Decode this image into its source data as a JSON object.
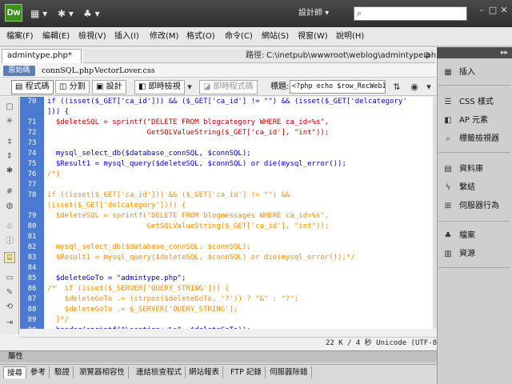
{
  "titlebar": {
    "logo": "Dw",
    "workspace": "設計師 ▾",
    "search_placeholder": "",
    "layout_icon": "layout-icon",
    "gear_icon": "gear-icon",
    "site_icon": "site-icon"
  },
  "menu": [
    "檔案(F)",
    "編輯(E)",
    "檢視(V)",
    "插入(I)",
    "修改(M)",
    "格式(O)",
    "命令(C)",
    "網站(S)",
    "視窗(W)",
    "說明(H)"
  ],
  "document": {
    "tab": "admintype.php*",
    "path_label": "路徑:",
    "path_value": "C:\\inetpub\\wwwroot\\weblog\\admintype.php",
    "source_code": "原始碼",
    "related_files": [
      "connSQL.php",
      "VectorLover.css"
    ]
  },
  "doc_toolbar": {
    "code": "程式碼",
    "split": "分割",
    "design": "設計",
    "live_view": "即時檢視",
    "live_code": "即時程式碼",
    "title_label": "標題:",
    "title_value": "<?php echo $row_RecWebInfo"
  },
  "code": {
    "line_numbers": [
      "70",
      "",
      "71",
      "72",
      "73",
      "74",
      "75",
      "76",
      "77",
      "78",
      "",
      "79",
      "80",
      "81",
      "82",
      "83",
      "84",
      "85",
      "86",
      "87",
      "88",
      "89",
      "90"
    ],
    "lines": [
      "if ((isset($_GET['ca_id'])) && ($_GET['ca_id'] != \"\") && (isset($_GET['delcategory'",
      "])) {",
      "  $deleteSQL = sprintf(\"DELETE FROM blogcategory WHERE ca_id=%s\",",
      "                       GetSQLValueString($_GET['ca_id'], \"int\"));",
      "",
      "  mysql_select_db($database_connSQL, $connSQL);",
      "  $Result1 = mysql_query($deleteSQL, $connSQL) or die(mysql_error());",
      "/*}",
      "",
      "if ((isset($_GET['ca_id'])) && ($_GET['ca_id'] != \"\") &&",
      "(isset($_GET['delcategory']))) {",
      "  $deleteSQL = sprintf(\"DELETE FROM blogmessages WHERE ca_id=%s\",",
      "                       GetSQLValueString($_GET['ca_id'], \"int\"));",
      "",
      "  mysql_select_db($database_connSQL, $connSQL);",
      "  $Result1 = mysql_query($deleteSQL, $connSQL) or die(mysql_error());*/",
      "",
      "  $deleteGoTo = \"admintype.php\";",
      "/*  if (isset($_SERVER['QUERY_STRING'])) {",
      "    $deleteGoTo .= (strpos($deleteGoTo, '?')) ? \"&\" : \"?\";",
      "    $deleteGoTo .= $_SERVER['QUERY_STRING'];",
      "  }*/",
      "  header(sprintf(\"Location: %s\", $deleteGoTo));"
    ]
  },
  "status": "22 K / 4 秒  Unicode (UTF-8)",
  "properties": "屬性",
  "bottom_tabs": [
    "搜尋",
    "參考",
    "驗證",
    "瀏覽器相容性",
    "連結檢查程式",
    "網站報表",
    "FTP 記錄",
    "伺服器除錯"
  ],
  "right_panel": {
    "insert": "插入",
    "css_styles": "CSS 樣式",
    "ap_elements": "AP 元素",
    "tag_inspector": "標籤檢視器",
    "databases": "資料庫",
    "bindings": "繫結",
    "server_behaviors": "伺服器行為",
    "files": "檔案",
    "assets": "資源"
  },
  "colors": {
    "gutter": "#4a7ad2",
    "php_code": "#000000",
    "string": "#cc0000",
    "variable": "#000000",
    "keyword": "#0000cc",
    "comment": "#ff8c00"
  }
}
